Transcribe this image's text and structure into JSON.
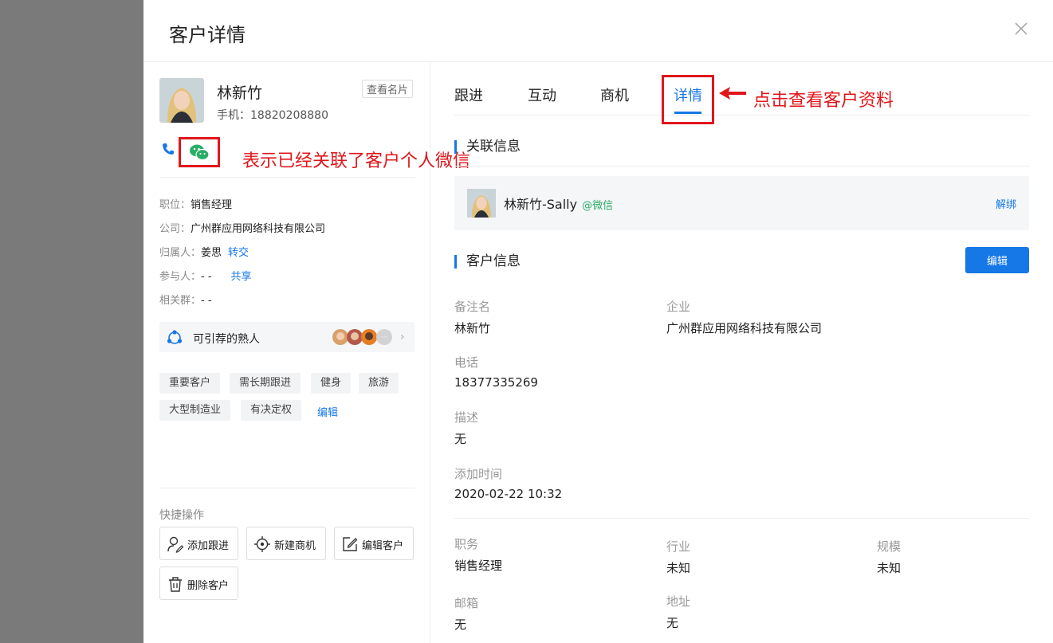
{
  "drawer": {
    "title": "客户详情"
  },
  "customer": {
    "name": "林新竹",
    "phone": "手机：18820208880",
    "view_card": "查看名片"
  },
  "annotations": {
    "wechat_note": "表示已经关联了客户个人微信",
    "tab_note": "点击查看客户资料"
  },
  "info": {
    "position_label": "职位：",
    "position_value": "销售经理",
    "company_label": "公司：",
    "company_value": "广州群应用网络科技有限公司",
    "owner_label": "归属人：",
    "owner_value": "姜思",
    "owner_action": "转交",
    "participant_label": "参与人：",
    "participant_value": "- -",
    "participant_action": "共享",
    "group_label": "相关群：",
    "group_value": "- -"
  },
  "recommend": {
    "label": "可引荐的熟人",
    "more": "···"
  },
  "tags": [
    "重要客户",
    "需长期跟进",
    "健身",
    "旅游",
    "大型制造业",
    "有决定权"
  ],
  "tags_edit": "编辑",
  "quick": {
    "title": "快捷操作",
    "add_followup": "添加跟进",
    "new_opportunity": "新建商机",
    "edit_customer": "编辑客户",
    "delete_customer": "删除客户"
  },
  "tabs": [
    "跟进",
    "互动",
    "商机",
    "详情"
  ],
  "linked": {
    "title": "关联信息",
    "name": "林新竹-Sally",
    "wechat": "@微信",
    "unbind": "解绑"
  },
  "customer_info": {
    "title": "客户信息",
    "edit": "编辑",
    "remark_label": "备注名",
    "remark_value": "林新竹",
    "enterprise_label": "企业",
    "enterprise_value": "广州群应用网络科技有限公司",
    "phone_label": "电话",
    "phone_value": "18377335269",
    "desc_label": "描述",
    "desc_value": "无",
    "added_label": "添加时间",
    "added_value": "2020-02-22 10:32",
    "duty_label": "职务",
    "duty_value": "销售经理",
    "industry_label": "行业",
    "industry_value": "未知",
    "scale_label": "规模",
    "scale_value": "未知",
    "email_label": "邮箱",
    "email_value": "无",
    "address_label": "地址",
    "address_value": "无"
  },
  "colors": {
    "accent": "#1677e6",
    "annotation": "#e0161b",
    "wechat": "#2aae67"
  }
}
